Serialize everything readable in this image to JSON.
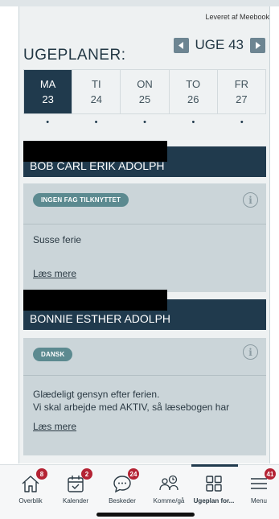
{
  "provider": {
    "label": "Leveret af Meebook"
  },
  "header": {
    "title": "UGEPLANER:",
    "week_label": "UGE 43"
  },
  "days": [
    {
      "abbr": "MA",
      "date": "23",
      "active": true
    },
    {
      "abbr": "TI",
      "date": "24",
      "active": false
    },
    {
      "abbr": "ON",
      "date": "25",
      "active": false
    },
    {
      "abbr": "TO",
      "date": "26",
      "active": false
    },
    {
      "abbr": "FR",
      "date": "27",
      "active": false
    }
  ],
  "day_dots": [
    "•",
    "•",
    "•",
    "•",
    "•"
  ],
  "children": [
    {
      "name": "BOB CARL ERIK ADOLPH",
      "card": {
        "tag": "INGEN FAG TILKNYTTET",
        "text": "Susse ferie",
        "read_more": "Læs mere"
      }
    },
    {
      "name": "BONNIE ESTHER ADOLPH",
      "card": {
        "tag": "DANSK",
        "text": "Glædeligt gensyn efter ferien.\nVi skal arbejde med AKTIV, så læsebogen har",
        "read_more": "Læs mere"
      }
    }
  ],
  "tabbar": {
    "items": [
      {
        "label": "Overblik",
        "icon": "house-icon",
        "badge": "8"
      },
      {
        "label": "Kalender",
        "icon": "calendar-icon",
        "badge": "2"
      },
      {
        "label": "Beskeder",
        "icon": "chat-bubble-icon",
        "badge": "24"
      },
      {
        "label": "Komme/gå",
        "icon": "people-clock-icon",
        "badge": ""
      },
      {
        "label": "Ugeplan for...",
        "icon": "grid-icon",
        "badge": ""
      },
      {
        "label": "Menu",
        "icon": "hamburger-menu-icon",
        "badge": "41"
      }
    ],
    "active_index": 4
  },
  "colors": {
    "navy": "#203a4d",
    "badge": "#b42334",
    "tag": "#5c8a90",
    "card": "#cbd5d9"
  }
}
